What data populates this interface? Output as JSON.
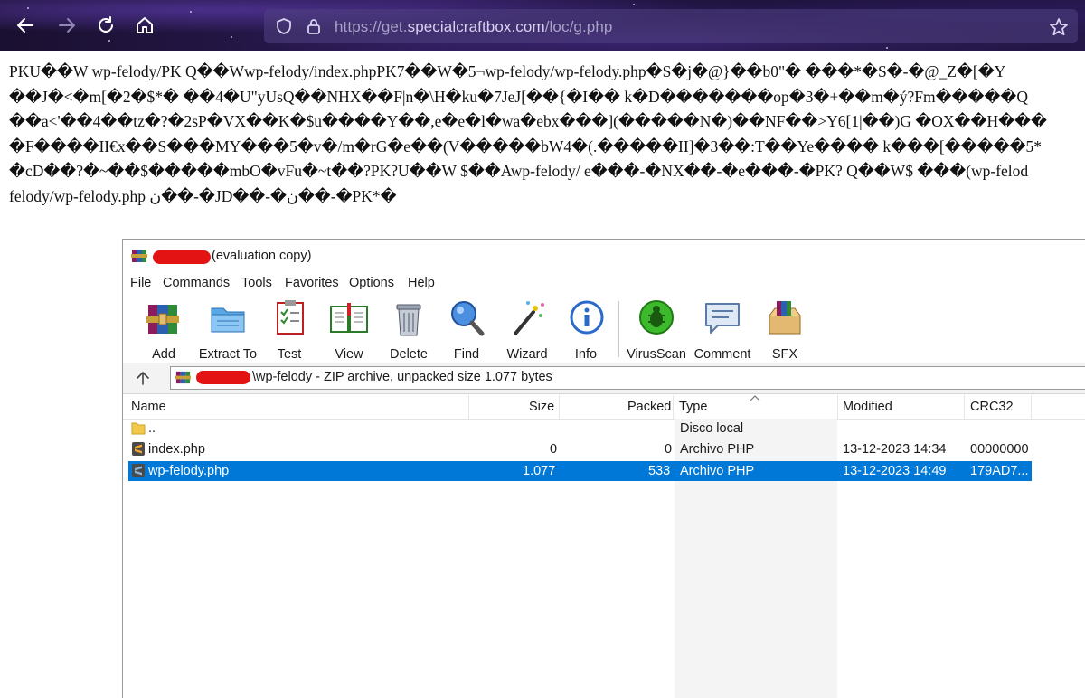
{
  "browser": {
    "url_prefix": "https://get.",
    "url_host": "specialcraftbox.com",
    "url_path": "/loc/g.php"
  },
  "page": {
    "raw_lines": [
      "PKU��W wp-felody/PK Q��Wwp-felody/index.phpPK7��W�5¬wp-felody/wp-felody.php�S�j�@}��b0\"� ���*�S�-�@_Z�[�Y",
      "��J�<�m[�2�$*� ��4�U\"yUsQ��NHX��F|n�\\H�ku�7JeJ[��{�I�� k�D�������op�3�+��m�ý?Fm�����Q",
      "��a<'��4��tz�?�2sP�VX��K�$u����Y��,e�e�l�wa�ebx���](�����N�)��NF��>Y6[1|��)G �OX��H���",
      "�F����II€x��S���MY���5�v�/m�rG�e��(V�����bW4�(.�����II]�3��:T��Ye���� k���[�����5*",
      "�cD��?�~��$�����mbO�vFu�~t��?PK?U��W $��Awp-felody/ e���-�NX��-�e���-�PK? Q��W$ ���(wp-felod",
      "felody/wp-felody.php ن��-�JD��-�ن��-�PK*�"
    ]
  },
  "winrar": {
    "title_suffix": "(evaluation copy)",
    "menu": [
      "File",
      "Commands",
      "Tools",
      "Favorites",
      "Options",
      "Help"
    ],
    "toolbar": [
      "Add",
      "Extract To",
      "Test",
      "View",
      "Delete",
      "Find",
      "Wizard",
      "Info",
      "VirusScan",
      "Comment",
      "SFX"
    ],
    "path_text": "\\wp-felody - ZIP archive, unpacked size 1.077 bytes",
    "columns": {
      "name": "Name",
      "size": "Size",
      "packed": "Packed",
      "type": "Type",
      "modified": "Modified",
      "crc": "CRC32"
    },
    "rows": [
      {
        "name": "..",
        "size": "",
        "packed": "",
        "type": "Disco local",
        "modified": "",
        "crc": ""
      },
      {
        "name": "index.php",
        "size": "0",
        "packed": "0",
        "type": "Archivo PHP",
        "modified": "13-12-2023 14:34",
        "crc": "00000000"
      },
      {
        "name": "wp-felody.php",
        "size": "1.077",
        "packed": "533",
        "type": "Archivo PHP",
        "modified": "13-12-2023 14:49",
        "crc": "179AD7..."
      }
    ],
    "selection_color": "#0078d7",
    "redaction_color": "#e31313"
  }
}
